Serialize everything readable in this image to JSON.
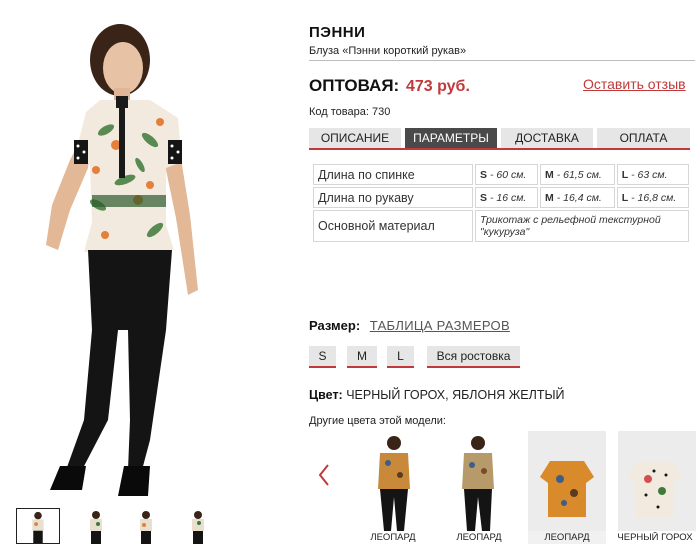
{
  "product": {
    "title": "ПЭННИ",
    "subtitle": "Блуза «Пэнни короткий рукав»",
    "price_label": "ОПТОВАЯ:",
    "price_value": "473 руб.",
    "review_link": "Оставить отзыв",
    "sku": "Код товара: 730"
  },
  "tabs": [
    {
      "label": "ОПИСАНИЕ",
      "active": false
    },
    {
      "label": "ПАРАМЕТРЫ",
      "active": true
    },
    {
      "label": "ДОСТАВКА",
      "active": false
    },
    {
      "label": "ОПЛАТА",
      "active": false
    }
  ],
  "params": {
    "rows": [
      {
        "label": "Длина по спинке",
        "s_size": "S",
        "s_val": "- 60 см.",
        "m_size": "M",
        "m_val": "- 61,5 см.",
        "l_size": "L",
        "l_val": "- 63 см."
      },
      {
        "label": "Длина по рукаву",
        "s_size": "S",
        "s_val": "- 16 см.",
        "m_size": "M",
        "m_val": "- 16,4 см.",
        "l_size": "L",
        "l_val": "- 16,8 см."
      }
    ],
    "material_label": "Основной материал",
    "material_value": "Трикотаж с рельефной текстурной \"кукуруза\""
  },
  "sizes": {
    "label": "Размер:",
    "table_link": "ТАБЛИЦА РАЗМЕРОВ",
    "options": [
      "S",
      "M",
      "L",
      "Вся ростовка"
    ]
  },
  "color": {
    "label": "Цвет:",
    "value": "ЧЕРНЫЙ ГОРОХ, ЯБЛОНЯ ЖЕЛТЫЙ",
    "other_label": "Другие цвета этой модели:",
    "variants": [
      "ЛЕОПАРД",
      "ЛЕОПАРД",
      "ЛЕОПАРД",
      "ЧЕРНЫЙ ГОРОХ"
    ]
  },
  "colors": {
    "accent": "#c0393b",
    "tab_active": "#4a4a4a",
    "tab_inactive": "#e6e6e6"
  }
}
